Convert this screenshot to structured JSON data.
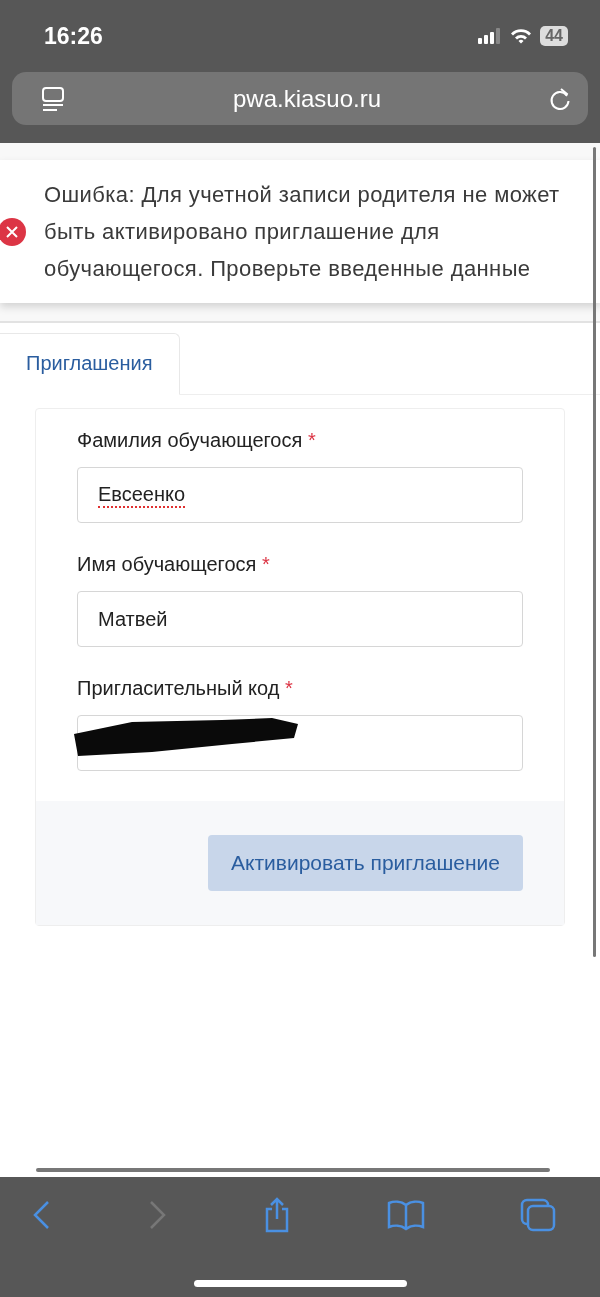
{
  "status_bar": {
    "time": "16:26",
    "battery": "44"
  },
  "address_bar": {
    "url": "pwa.kiasuo.ru"
  },
  "toast": {
    "kind": "error",
    "message": "Ошибка: Для учетной записи родителя не может быть активировано приглашение для обучающегося. Проверьте введенные данные"
  },
  "tabs": [
    {
      "label": "Приглашения",
      "selected": true
    }
  ],
  "form": {
    "fields": [
      {
        "label": "Фамилия обучающегося",
        "required_mark": "*",
        "value": "Евсеенко",
        "spellcheck_error": true,
        "redacted": false
      },
      {
        "label": "Имя обучающегося",
        "required_mark": "*",
        "value": "Матвей",
        "spellcheck_error": false,
        "redacted": false
      },
      {
        "label": "Пригласительный код",
        "required_mark": "*",
        "redacted": true
      }
    ],
    "submit": "Активировать приглашение"
  },
  "toolbar": {
    "back_disabled": false,
    "forward_disabled": true
  }
}
